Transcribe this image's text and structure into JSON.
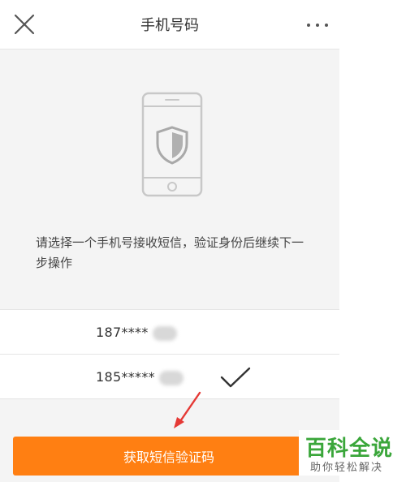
{
  "header": {
    "title": "手机号码",
    "close_icon": "close-icon",
    "more_icon": "more-icon"
  },
  "hero": {
    "illustration_icon": "phone-shield-icon",
    "instruction": "请选择一个手机号接收短信，验证身份后继续下一步操作"
  },
  "phone_list": [
    {
      "number": "187****",
      "selected": false
    },
    {
      "number": "185*****",
      "selected": true
    }
  ],
  "action": {
    "submit_label": "获取短信验证码"
  },
  "watermark": {
    "title": "百科全说",
    "subtitle": "助你轻松解决"
  },
  "colors": {
    "accent": "#ff7f12",
    "annotation_arrow": "#e53935",
    "watermark_green": "#3aa63a"
  }
}
